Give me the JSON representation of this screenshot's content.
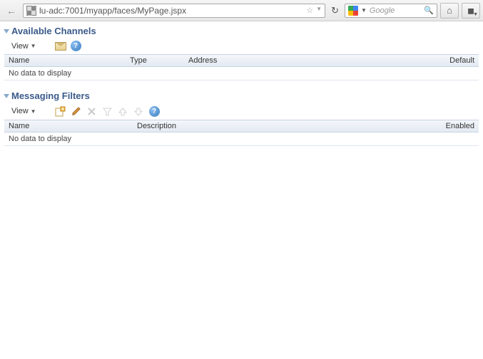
{
  "browser": {
    "url": "lu-adc:7001/myapp/faces/MyPage.jspx",
    "search_placeholder": "Google"
  },
  "panels": {
    "channels": {
      "title": "Available Channels",
      "view_label": "View",
      "columns": {
        "name": "Name",
        "type": "Type",
        "address": "Address",
        "default": "Default"
      },
      "empty": "No data to display"
    },
    "filters": {
      "title": "Messaging Filters",
      "view_label": "View",
      "columns": {
        "name": "Name",
        "description": "Description",
        "enabled": "Enabled"
      },
      "empty": "No data to display"
    }
  }
}
